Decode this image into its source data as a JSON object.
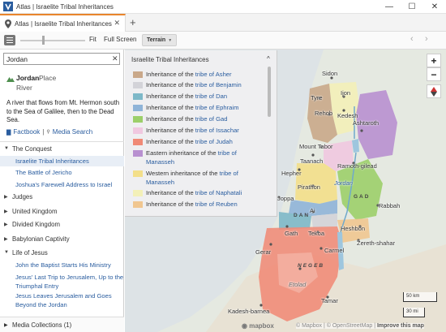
{
  "window": {
    "title": "Atlas | Israelite Tribal Inheritances",
    "controls": [
      "—",
      "☐",
      "✕"
    ]
  },
  "tabs": [
    {
      "label": "Atlas | Israelite Tribal Inheritances",
      "close": "✕"
    }
  ],
  "new_tab": "+",
  "toolbar": {
    "fit": "Fit",
    "full_screen": "Full Screen",
    "terrain": "Terrain",
    "back": "‹",
    "forward": "›"
  },
  "search": {
    "value": "Jordan",
    "clear": "✕"
  },
  "place": {
    "name": "Jordan",
    "type": "Place",
    "subtype": "River",
    "description": "A river that flows from Mt. Hermon south to the Sea of Galilee, then to the Dead Sea.",
    "links": {
      "factbook": "Factbook",
      "separator": "|",
      "media_search": "Media Search"
    }
  },
  "sidebar": {
    "categories": [
      {
        "label": "The Conquest",
        "expanded": true,
        "items": [
          "Israelite Tribal Inheritances",
          "The Battle of Jericho",
          "Joshua's Farewell Address to Israel"
        ]
      },
      {
        "label": "Judges",
        "expanded": false,
        "items": []
      },
      {
        "label": "United Kingdom",
        "expanded": false,
        "items": []
      },
      {
        "label": "Divided Kingdom",
        "expanded": false,
        "items": []
      },
      {
        "label": "Babylonian Captivity",
        "expanded": false,
        "items": []
      },
      {
        "label": "Life of Jesus",
        "expanded": true,
        "items": [
          "John the Baptist Starts His Ministry",
          "Jesus' Last Trip to Jerusalem, Up to the Triumphal Entry",
          "Jesus Leaves Jerusalem and Goes Beyond the Jordan"
        ]
      }
    ],
    "active_item": "Israelite Tribal Inheritances",
    "media_collections": "Media Collections (1)"
  },
  "legend": {
    "title": "Israelite Tribal Inheritances",
    "collapse_icon": "^",
    "items": [
      {
        "prefix": "Inheritance of the ",
        "tribe": "tribe of Asher",
        "color": "#c9a88a"
      },
      {
        "prefix": "Inheritance of the ",
        "tribe": "tribe of Benjamin",
        "color": "#d3d3d8"
      },
      {
        "prefix": "Inheritance of the ",
        "tribe": "tribe of Dan",
        "color": "#7db8c8"
      },
      {
        "prefix": "Inheritance of the ",
        "tribe": "tribe of Ephraim",
        "color": "#8fb4d8"
      },
      {
        "prefix": "Inheritance of the ",
        "tribe": "tribe of Gad",
        "color": "#9ccf6a"
      },
      {
        "prefix": "Inheritance of the ",
        "tribe": "tribe of Issachar",
        "color": "#f0c8e0"
      },
      {
        "prefix": "Inheritance of the ",
        "tribe": "tribe of Judah",
        "color": "#f08a76"
      },
      {
        "prefix": "Eastern inheritance of the ",
        "tribe": "tribe of Manasseh",
        "color": "#b890d0"
      },
      {
        "prefix": "Western inheritance of the ",
        "tribe": "tribe of Manasseh",
        "color": "#f3df8a"
      },
      {
        "prefix": "Inheritance of the ",
        "tribe": "tribe of Naphatali",
        "color": "#f3f0b8"
      },
      {
        "prefix": "Inheritance of the ",
        "tribe": "tribe of Reuben",
        "color": "#f0c690"
      }
    ]
  },
  "map": {
    "places": [
      "Sidon",
      "Tyre",
      "Ijon",
      "Kedesh",
      "Rehob",
      "Ashtaroth",
      "Mount Tabor",
      "Taanach",
      "Ramoth-gilead",
      "Hepher",
      "Pirathon",
      "Jordan",
      "Joppa",
      "Ai",
      "Rabbah",
      "Gath",
      "Tekoa",
      "Heshbon",
      "Gerar",
      "Carmel",
      "Zereth-shahar",
      "Etolad",
      "Tamar",
      "Kadesh-barnea"
    ],
    "tribe_labels": [
      "GAD",
      "DAN",
      "NEGEB"
    ],
    "zoom_in": "+",
    "zoom_out": "−",
    "scale_km": "50 km",
    "scale_mi": "30 mi",
    "attribution": {
      "mapbox": "© Mapbox",
      "osm": "© OpenStreetMap",
      "improve": "Improve this map"
    }
  }
}
